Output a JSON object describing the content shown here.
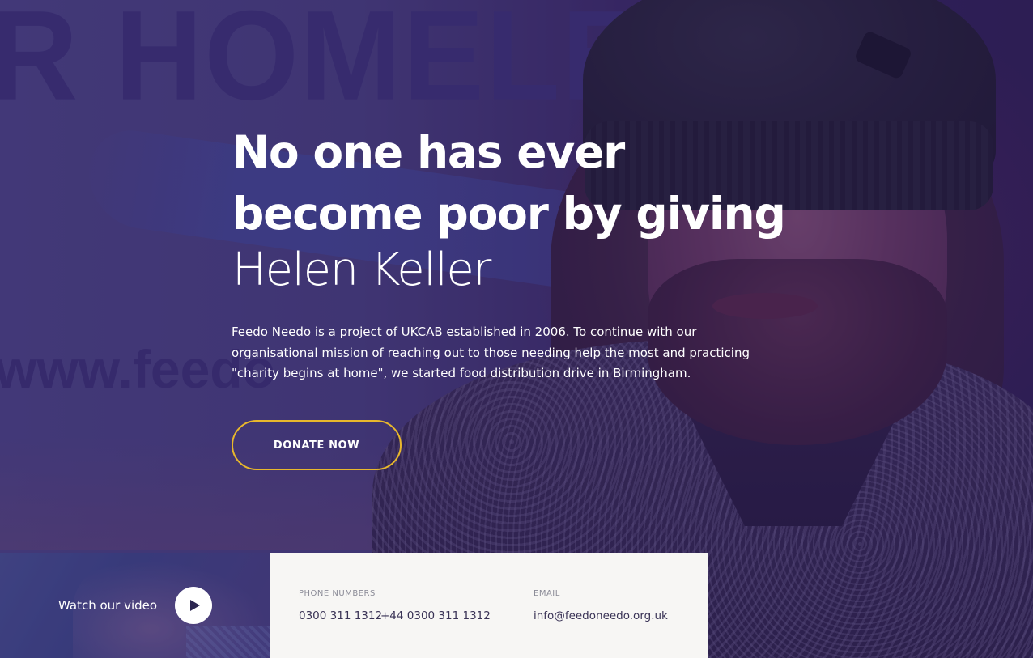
{
  "hero": {
    "headline_line1": "No one has ever",
    "headline_line2": "become poor by giving",
    "author": "Helen Keller",
    "lead": "Feedo Needo is a project of UKCAB established in 2006. To continue with our organisational mission of reaching out to those needing help the most and practicing \"charity begins at home\", we started food distribution drive in Birmingham.",
    "donate_label": "DONATE NOW",
    "background_banner_text": "R HOMELESS",
    "background_banner_url": "www.feedo",
    "accent_color": "#e8b82c",
    "tint_color": "#301c60"
  },
  "video": {
    "label": "Watch our video",
    "play_icon": "play-icon"
  },
  "contact": {
    "phone_label": "PHONE NUMBERS",
    "phone_1": "0300 311 1312",
    "phone_2": "+44 0300 311 1312",
    "email_label": "EMAIL",
    "email": "info@feedoneedo.org.uk",
    "panel_color": "#f7f6f4",
    "text_color": "#3a3356"
  }
}
